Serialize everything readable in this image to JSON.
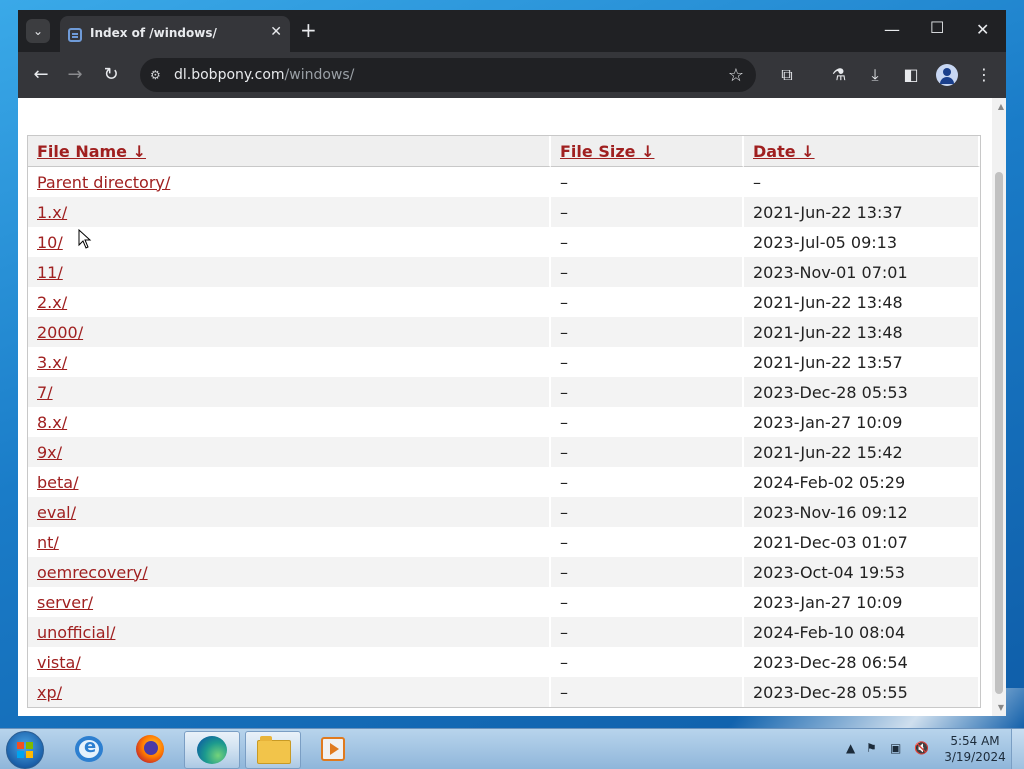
{
  "browser": {
    "tab_title": "Index of /windows/",
    "url_host": "dl.bobpony.com",
    "url_path": "/windows/"
  },
  "table": {
    "headers": {
      "name": "File Name ↓",
      "size": "File Size ↓",
      "date": "Date ↓"
    },
    "rows": [
      {
        "name": "Parent directory/",
        "size": "–",
        "date": "–"
      },
      {
        "name": "1.x/",
        "size": "–",
        "date": "2021-Jun-22 13:37"
      },
      {
        "name": "10/",
        "size": "–",
        "date": "2023-Jul-05 09:13"
      },
      {
        "name": "11/",
        "size": "–",
        "date": "2023-Nov-01 07:01"
      },
      {
        "name": "2.x/",
        "size": "–",
        "date": "2021-Jun-22 13:48"
      },
      {
        "name": "2000/",
        "size": "–",
        "date": "2021-Jun-22 13:48"
      },
      {
        "name": "3.x/",
        "size": "–",
        "date": "2021-Jun-22 13:57"
      },
      {
        "name": "7/",
        "size": "–",
        "date": "2023-Dec-28 05:53"
      },
      {
        "name": "8.x/",
        "size": "–",
        "date": "2023-Jan-27 10:09"
      },
      {
        "name": "9x/",
        "size": "–",
        "date": "2021-Jun-22 15:42"
      },
      {
        "name": "beta/",
        "size": "–",
        "date": "2024-Feb-02 05:29"
      },
      {
        "name": "eval/",
        "size": "–",
        "date": "2023-Nov-16 09:12"
      },
      {
        "name": "nt/",
        "size": "–",
        "date": "2021-Dec-03 01:07"
      },
      {
        "name": "oemrecovery/",
        "size": "–",
        "date": "2023-Oct-04 19:53"
      },
      {
        "name": "server/",
        "size": "–",
        "date": "2023-Jan-27 10:09"
      },
      {
        "name": "unofficial/",
        "size": "–",
        "date": "2024-Feb-10 08:04"
      },
      {
        "name": "vista/",
        "size": "–",
        "date": "2023-Dec-28 06:54"
      },
      {
        "name": "xp/",
        "size": "–",
        "date": "2023-Dec-28 05:55"
      }
    ]
  },
  "taskbar": {
    "time": "5:54 AM",
    "date": "3/19/2024"
  },
  "colors": {
    "link": "#a02020",
    "browser_dark": "#202124",
    "toolbar": "#35363a"
  }
}
